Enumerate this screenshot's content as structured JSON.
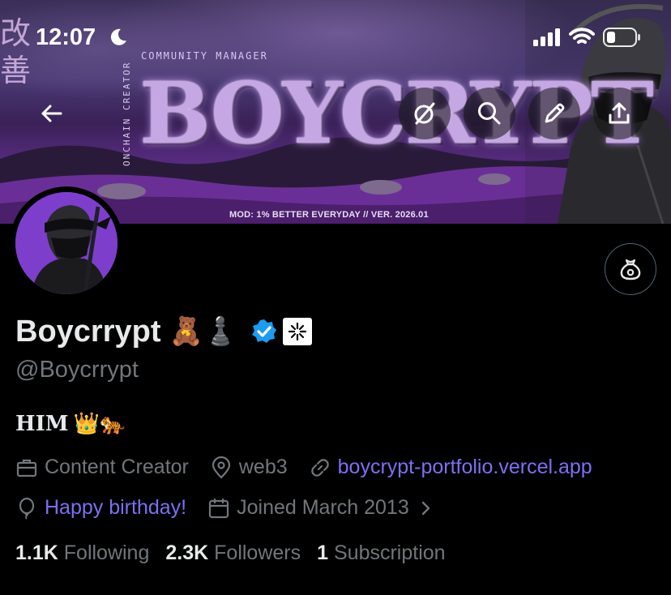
{
  "status_bar": {
    "time": "12:07"
  },
  "banner": {
    "kanji": "改善",
    "community_label": "COMMUNITY MANAGER",
    "onchain_label": "ONCHAIN CREATOR",
    "brand_text": "BOYCRYPT",
    "tagline": "MOD: 1% BETTER EVERYDAY  // VER. 2026.01"
  },
  "icons": {
    "back": "arrow-left-icon",
    "grok": "grok-slash-circle-icon",
    "search": "search-icon",
    "edit": "pencil-icon",
    "share": "share-upload-icon",
    "tip": "money-bag-icon"
  },
  "profile": {
    "name": "Boycrrypt",
    "name_emojis": "🧸♟️",
    "handle": "@Boycrrypt",
    "bio_text": "HIM",
    "bio_emojis": "👑🐅",
    "category": "Content Creator",
    "location": "web3",
    "website": "boycrypt-portfolio.vercel.app",
    "birthday": "Happy birthday!",
    "joined": "Joined March 2013"
  },
  "stats": {
    "following_count": "1.1K",
    "following_label": "Following",
    "followers_count": "2.3K",
    "followers_label": "Followers",
    "subscription_count": "1",
    "subscription_label": "Subscription"
  },
  "colors": {
    "background": "#000000",
    "text": "#e7e9ea",
    "muted": "#71767b",
    "link": "#7c70f0",
    "verified": "#1d9bf0",
    "banner_purple": "#5b2c86"
  }
}
